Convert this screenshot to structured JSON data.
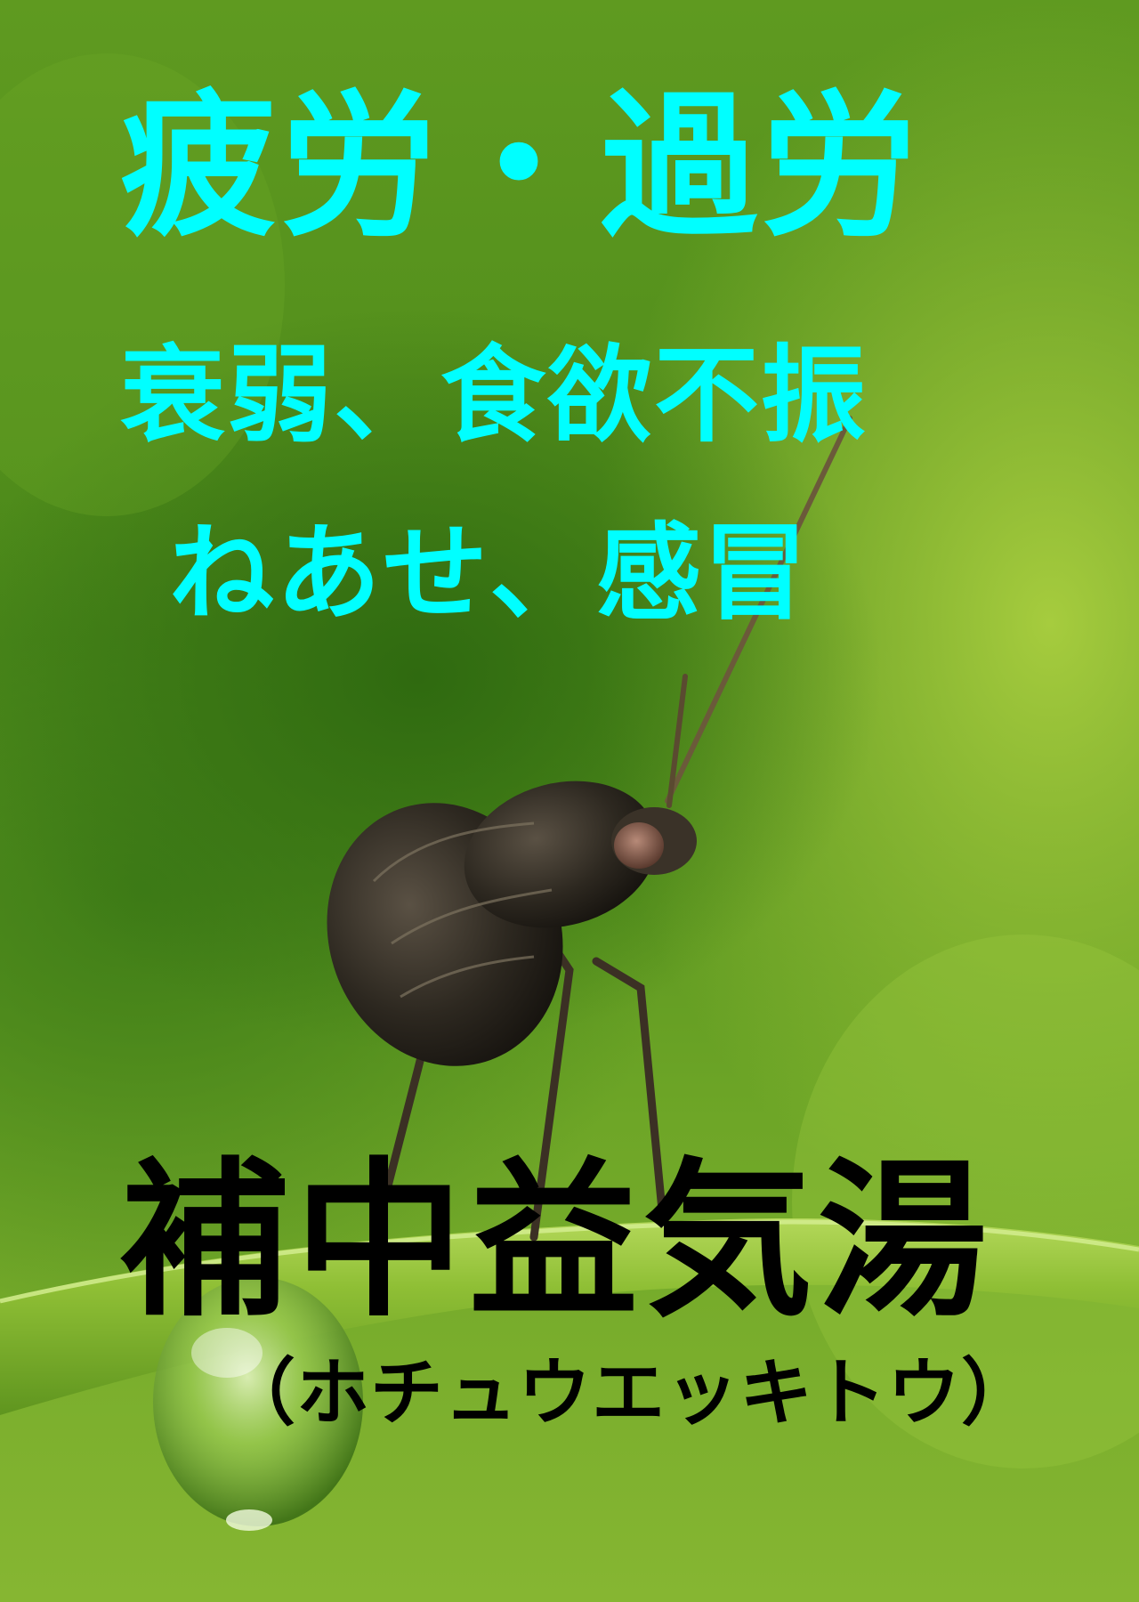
{
  "poster": {
    "line1": "疲労・過労",
    "line2": "衰弱、食欲不振",
    "line3": "ねあせ、感冒",
    "line4": "補中益気湯",
    "line5": "（ホチュウエッキトウ）"
  },
  "colors": {
    "headline": "#00ffff",
    "title": "#000000",
    "background": "#5f9a20"
  }
}
